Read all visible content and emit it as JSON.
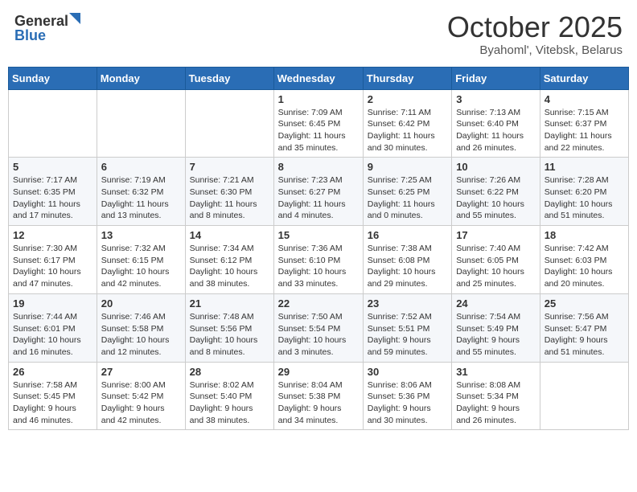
{
  "header": {
    "logo_general": "General",
    "logo_blue": "Blue",
    "month": "October 2025",
    "location": "Byahoml', Vitebsk, Belarus"
  },
  "weekdays": [
    "Sunday",
    "Monday",
    "Tuesday",
    "Wednesday",
    "Thursday",
    "Friday",
    "Saturday"
  ],
  "weeks": [
    [
      {
        "day": "",
        "info": ""
      },
      {
        "day": "",
        "info": ""
      },
      {
        "day": "",
        "info": ""
      },
      {
        "day": "1",
        "info": "Sunrise: 7:09 AM\nSunset: 6:45 PM\nDaylight: 11 hours\nand 35 minutes."
      },
      {
        "day": "2",
        "info": "Sunrise: 7:11 AM\nSunset: 6:42 PM\nDaylight: 11 hours\nand 30 minutes."
      },
      {
        "day": "3",
        "info": "Sunrise: 7:13 AM\nSunset: 6:40 PM\nDaylight: 11 hours\nand 26 minutes."
      },
      {
        "day": "4",
        "info": "Sunrise: 7:15 AM\nSunset: 6:37 PM\nDaylight: 11 hours\nand 22 minutes."
      }
    ],
    [
      {
        "day": "5",
        "info": "Sunrise: 7:17 AM\nSunset: 6:35 PM\nDaylight: 11 hours\nand 17 minutes."
      },
      {
        "day": "6",
        "info": "Sunrise: 7:19 AM\nSunset: 6:32 PM\nDaylight: 11 hours\nand 13 minutes."
      },
      {
        "day": "7",
        "info": "Sunrise: 7:21 AM\nSunset: 6:30 PM\nDaylight: 11 hours\nand 8 minutes."
      },
      {
        "day": "8",
        "info": "Sunrise: 7:23 AM\nSunset: 6:27 PM\nDaylight: 11 hours\nand 4 minutes."
      },
      {
        "day": "9",
        "info": "Sunrise: 7:25 AM\nSunset: 6:25 PM\nDaylight: 11 hours\nand 0 minutes."
      },
      {
        "day": "10",
        "info": "Sunrise: 7:26 AM\nSunset: 6:22 PM\nDaylight: 10 hours\nand 55 minutes."
      },
      {
        "day": "11",
        "info": "Sunrise: 7:28 AM\nSunset: 6:20 PM\nDaylight: 10 hours\nand 51 minutes."
      }
    ],
    [
      {
        "day": "12",
        "info": "Sunrise: 7:30 AM\nSunset: 6:17 PM\nDaylight: 10 hours\nand 47 minutes."
      },
      {
        "day": "13",
        "info": "Sunrise: 7:32 AM\nSunset: 6:15 PM\nDaylight: 10 hours\nand 42 minutes."
      },
      {
        "day": "14",
        "info": "Sunrise: 7:34 AM\nSunset: 6:12 PM\nDaylight: 10 hours\nand 38 minutes."
      },
      {
        "day": "15",
        "info": "Sunrise: 7:36 AM\nSunset: 6:10 PM\nDaylight: 10 hours\nand 33 minutes."
      },
      {
        "day": "16",
        "info": "Sunrise: 7:38 AM\nSunset: 6:08 PM\nDaylight: 10 hours\nand 29 minutes."
      },
      {
        "day": "17",
        "info": "Sunrise: 7:40 AM\nSunset: 6:05 PM\nDaylight: 10 hours\nand 25 minutes."
      },
      {
        "day": "18",
        "info": "Sunrise: 7:42 AM\nSunset: 6:03 PM\nDaylight: 10 hours\nand 20 minutes."
      }
    ],
    [
      {
        "day": "19",
        "info": "Sunrise: 7:44 AM\nSunset: 6:01 PM\nDaylight: 10 hours\nand 16 minutes."
      },
      {
        "day": "20",
        "info": "Sunrise: 7:46 AM\nSunset: 5:58 PM\nDaylight: 10 hours\nand 12 minutes."
      },
      {
        "day": "21",
        "info": "Sunrise: 7:48 AM\nSunset: 5:56 PM\nDaylight: 10 hours\nand 8 minutes."
      },
      {
        "day": "22",
        "info": "Sunrise: 7:50 AM\nSunset: 5:54 PM\nDaylight: 10 hours\nand 3 minutes."
      },
      {
        "day": "23",
        "info": "Sunrise: 7:52 AM\nSunset: 5:51 PM\nDaylight: 9 hours\nand 59 minutes."
      },
      {
        "day": "24",
        "info": "Sunrise: 7:54 AM\nSunset: 5:49 PM\nDaylight: 9 hours\nand 55 minutes."
      },
      {
        "day": "25",
        "info": "Sunrise: 7:56 AM\nSunset: 5:47 PM\nDaylight: 9 hours\nand 51 minutes."
      }
    ],
    [
      {
        "day": "26",
        "info": "Sunrise: 7:58 AM\nSunset: 5:45 PM\nDaylight: 9 hours\nand 46 minutes."
      },
      {
        "day": "27",
        "info": "Sunrise: 8:00 AM\nSunset: 5:42 PM\nDaylight: 9 hours\nand 42 minutes."
      },
      {
        "day": "28",
        "info": "Sunrise: 8:02 AM\nSunset: 5:40 PM\nDaylight: 9 hours\nand 38 minutes."
      },
      {
        "day": "29",
        "info": "Sunrise: 8:04 AM\nSunset: 5:38 PM\nDaylight: 9 hours\nand 34 minutes."
      },
      {
        "day": "30",
        "info": "Sunrise: 8:06 AM\nSunset: 5:36 PM\nDaylight: 9 hours\nand 30 minutes."
      },
      {
        "day": "31",
        "info": "Sunrise: 8:08 AM\nSunset: 5:34 PM\nDaylight: 9 hours\nand 26 minutes."
      },
      {
        "day": "",
        "info": ""
      }
    ]
  ]
}
